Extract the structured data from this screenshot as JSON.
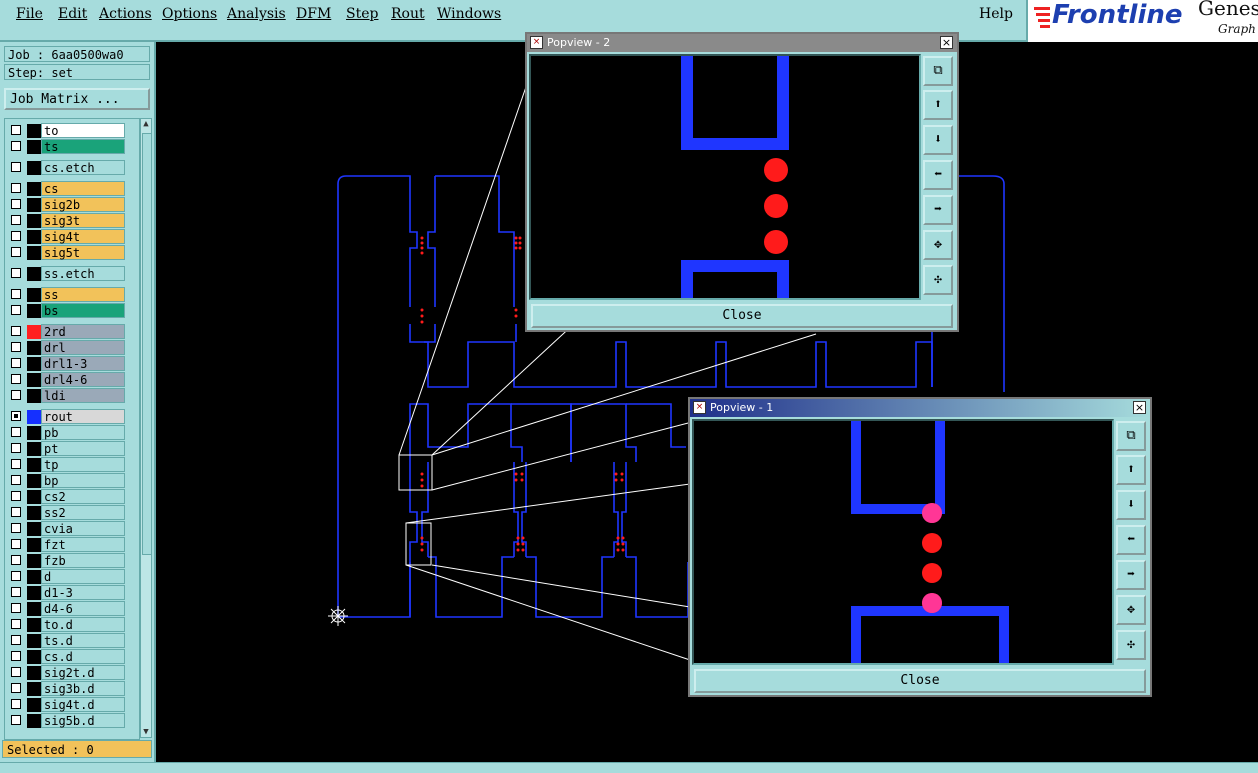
{
  "menubar": {
    "items": [
      "File",
      "Edit",
      "Actions",
      "Options",
      "Analysis",
      "DFM",
      "Step",
      "Rout",
      "Windows"
    ],
    "help": "Help"
  },
  "logo": {
    "brand": "Frontline",
    "product": "Genes",
    "sub": "Graph"
  },
  "job": {
    "label": "Job : 6aa0500wa0",
    "step": "Step: set",
    "matrix_button": "Job Matrix ..."
  },
  "layers": [
    {
      "name": "to",
      "color": "#ffffff",
      "chk": false
    },
    {
      "name": "ts",
      "color": "#1aa37a",
      "chk": false
    },
    {
      "name": "cs.etch",
      "color": "#a6dcdc",
      "chk": false
    },
    {
      "name": "cs",
      "color": "#f2c25a",
      "chk": false
    },
    {
      "name": "sig2b",
      "color": "#f2c25a",
      "chk": false
    },
    {
      "name": "sig3t",
      "color": "#f2c25a",
      "chk": false
    },
    {
      "name": "sig4t",
      "color": "#f2c25a",
      "chk": false
    },
    {
      "name": "sig5t",
      "color": "#f2c25a",
      "chk": false
    },
    {
      "name": "ss.etch",
      "color": "#a6dcdc",
      "chk": false
    },
    {
      "name": "ss",
      "color": "#f2c25a",
      "chk": false
    },
    {
      "name": "bs",
      "color": "#1aa37a",
      "chk": false
    },
    {
      "name": "2rd",
      "color": "#9aa9b8",
      "chk": false,
      "swatch": "#ff2020"
    },
    {
      "name": "drl",
      "color": "#9aa9b8",
      "chk": false
    },
    {
      "name": "drl1-3",
      "color": "#9aa9b8",
      "chk": false
    },
    {
      "name": "drl4-6",
      "color": "#9aa9b8",
      "chk": false
    },
    {
      "name": "ldi",
      "color": "#9aa9b8",
      "chk": false
    },
    {
      "name": "rout",
      "color": "#d8d8d8",
      "chk": true,
      "swatch": "#1530ff"
    },
    {
      "name": "pb",
      "color": "#a6dcdc",
      "chk": false
    },
    {
      "name": "pt",
      "color": "#a6dcdc",
      "chk": false
    },
    {
      "name": "tp",
      "color": "#a6dcdc",
      "chk": false
    },
    {
      "name": "bp",
      "color": "#a6dcdc",
      "chk": false
    },
    {
      "name": "cs2",
      "color": "#a6dcdc",
      "chk": false
    },
    {
      "name": "ss2",
      "color": "#a6dcdc",
      "chk": false
    },
    {
      "name": "cvia",
      "color": "#a6dcdc",
      "chk": false
    },
    {
      "name": "fzt",
      "color": "#a6dcdc",
      "chk": false
    },
    {
      "name": "fzb",
      "color": "#a6dcdc",
      "chk": false
    },
    {
      "name": "d",
      "color": "#a6dcdc",
      "chk": false
    },
    {
      "name": "d1-3",
      "color": "#a6dcdc",
      "chk": false
    },
    {
      "name": "d4-6",
      "color": "#a6dcdc",
      "chk": false
    },
    {
      "name": "to.d",
      "color": "#a6dcdc",
      "chk": false
    },
    {
      "name": "ts.d",
      "color": "#a6dcdc",
      "chk": false
    },
    {
      "name": "cs.d",
      "color": "#a6dcdc",
      "chk": false
    },
    {
      "name": "sig2t.d",
      "color": "#a6dcdc",
      "chk": false
    },
    {
      "name": "sig3b.d",
      "color": "#a6dcdc",
      "chk": false
    },
    {
      "name": "sig4t.d",
      "color": "#a6dcdc",
      "chk": false
    },
    {
      "name": "sig5b.d",
      "color": "#a6dcdc",
      "chk": false
    }
  ],
  "status": {
    "selected": "Selected : 0"
  },
  "popview2": {
    "title": "Popview - 2",
    "close": "Close"
  },
  "popview1": {
    "title": "Popview - 1",
    "close": "Close"
  },
  "colors": {
    "route": "#1f36ff",
    "pad": "#ff1b1b",
    "panel": "#a6dcdc",
    "accent": "#f2c25a"
  },
  "tool_icons": [
    "zoom-fit-icon",
    "pan-up-icon",
    "pan-down-icon",
    "pan-left-icon",
    "pan-right-icon",
    "zoom-in-icon",
    "zoom-out-icon"
  ]
}
